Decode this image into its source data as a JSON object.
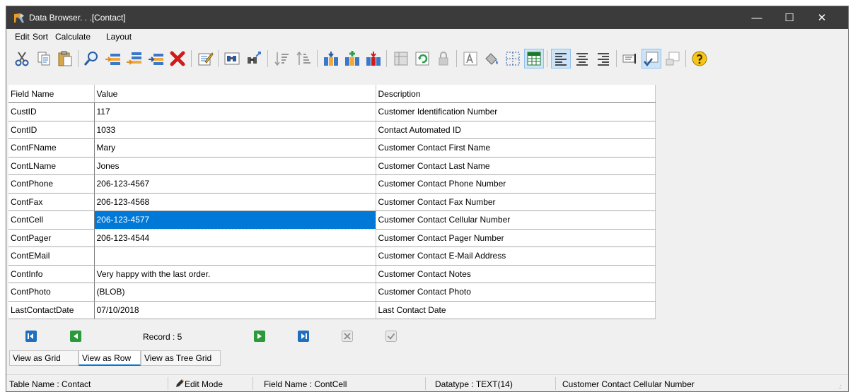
{
  "window": {
    "title": "Data Browser. . .[Contact]",
    "controls": {
      "minimize": "—",
      "maximize": "☐",
      "close": "✕"
    }
  },
  "menu": [
    "Edit",
    "Sort",
    "Calculate",
    "Layout"
  ],
  "toolbar": {
    "icons": [
      "cut-icon",
      "copy-icon",
      "paste-icon",
      "find-icon",
      "insert-record-icon",
      "append-record-icon",
      "insert-row-icon",
      "delete-record-icon",
      "edit-memo-icon",
      "find-in-column-icon",
      "find-next-icon",
      "sort-ascending-icon",
      "sort-descending-icon",
      "add-column-icon",
      "insert-column-icon",
      "remove-column-icon",
      "table-properties-icon",
      "refresh-icon",
      "lock-icon",
      "font-icon",
      "fill-color-icon",
      "select-all-icon",
      "grid-lines-icon",
      "align-left-icon",
      "align-center-icon",
      "align-right-icon",
      "spell-check-icon",
      "commit-icon",
      "rollback-icon",
      "help-icon"
    ],
    "active": [
      "grid-lines-icon",
      "align-left-icon",
      "commit-icon"
    ]
  },
  "grid": {
    "columns": [
      "Field Name",
      "Value",
      "Description"
    ],
    "rows": [
      {
        "field": "CustID",
        "value": "117",
        "description": "Customer Identification Number"
      },
      {
        "field": "ContID",
        "value": "1033",
        "description": "Contact Automated ID"
      },
      {
        "field": "ContFName",
        "value": "Mary",
        "description": "Customer Contact First Name"
      },
      {
        "field": "ContLName",
        "value": "Jones",
        "description": "Customer Contact Last Name"
      },
      {
        "field": "ContPhone",
        "value": "206-123-4567",
        "description": "Customer Contact Phone Number"
      },
      {
        "field": "ContFax",
        "value": "206-123-4568",
        "description": "Customer Contact Fax Number"
      },
      {
        "field": "ContCell",
        "value": "206-123-4577",
        "description": "Customer Contact Cellular Number"
      },
      {
        "field": "ContPager",
        "value": "206-123-4544",
        "description": "Customer Contact Pager Number"
      },
      {
        "field": "ContEMail",
        "value": "",
        "description": "Customer Contact E-Mail Address"
      },
      {
        "field": "ContInfo",
        "value": "Very happy with the last order.",
        "description": "Customer Contact Notes"
      },
      {
        "field": "ContPhoto",
        "value": "(BLOB)",
        "description": "Customer Contact Photo"
      },
      {
        "field": "LastContactDate",
        "value": "07/10/2018",
        "description": "Last Contact Date"
      }
    ],
    "selected_row": 6,
    "selected_column": "Value",
    "selection_color": "#0078d7"
  },
  "navigator": {
    "record_label": "Record : 5",
    "buttons": [
      "first-record-icon",
      "prior-record-icon",
      "next-record-icon",
      "last-record-icon",
      "cancel-edit-icon",
      "post-edit-icon"
    ]
  },
  "tabs": [
    "View as Grid",
    "View as Row",
    "View as Tree Grid"
  ],
  "active_tab": "View as Row",
  "status": {
    "table_name": "Table Name : Contact",
    "mode": "Edit Mode",
    "field_name": "Field Name : ContCell",
    "datatype": "Datatype : TEXT(14)",
    "description": "Customer Contact Cellular Number",
    "grip": ".:"
  }
}
